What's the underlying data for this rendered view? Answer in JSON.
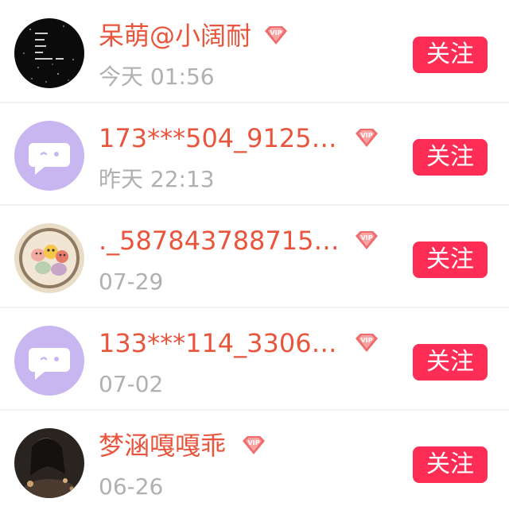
{
  "follow_list": {
    "items": [
      {
        "name": "呆萌@小阔耐",
        "time": "今天 01:56",
        "vip": true,
        "follow_label": "关注",
        "avatar": "dark-text-photo"
      },
      {
        "name": "173***504_9125…",
        "time": "昨天 22:13",
        "vip": true,
        "follow_label": "关注",
        "avatar": "default-chat-bubble"
      },
      {
        "name": "._587843788715…",
        "time": "07-29",
        "vip": true,
        "follow_label": "关注",
        "avatar": "cartoon-bowl"
      },
      {
        "name": "133***114_3306…",
        "time": "07-02",
        "vip": true,
        "follow_label": "关注",
        "avatar": "default-chat-bubble"
      },
      {
        "name": "梦涵嘎嘎乖",
        "time": "06-26",
        "vip": true,
        "follow_label": "关注",
        "avatar": "dark-portrait-photo"
      }
    ]
  },
  "colors": {
    "name": "#e8553c",
    "time": "#b0b0b0",
    "follow_button": "#fd2d55",
    "vip_badge": "#f06b6b",
    "default_avatar": "#c8b6f0"
  }
}
